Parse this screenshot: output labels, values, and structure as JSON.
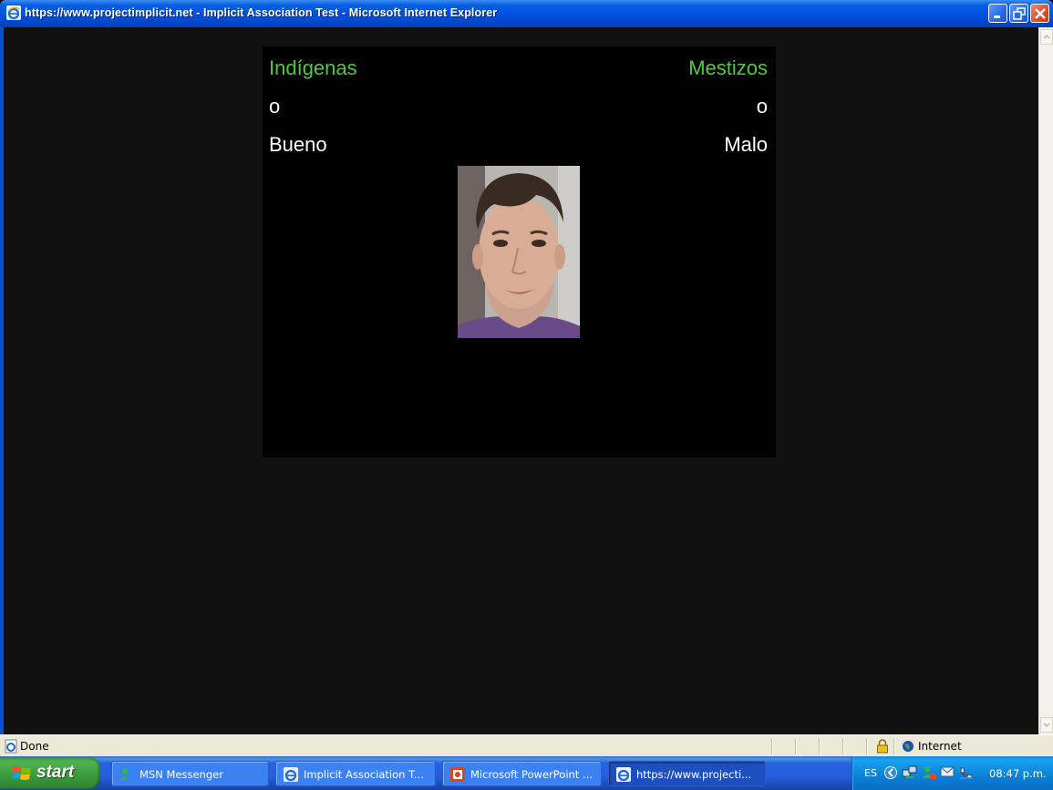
{
  "window": {
    "title": "https://www.projectimplicit.net - Implicit Association Test - Microsoft Internet Explorer"
  },
  "iat": {
    "left_top": "Indígenas",
    "left_or": "o",
    "left_bottom": "Bueno",
    "right_top": "Mestizos",
    "right_or": "o",
    "right_bottom": "Malo",
    "stimulus_icon": "face-photo"
  },
  "statusbar": {
    "status": "Done",
    "zone": "Internet"
  },
  "taskbar": {
    "start_label": "start",
    "tasks": [
      {
        "label": "MSN Messenger"
      },
      {
        "label": "Implicit Association T..."
      },
      {
        "label": "Microsoft PowerPoint ..."
      },
      {
        "label": "https://www.projecti..."
      }
    ],
    "language": "ES",
    "clock": "08:47 p.m."
  },
  "colors": {
    "target_category": "#4ccc3c",
    "attribute_category": "#ffffff",
    "stage_background": "#000000",
    "page_background": "#111111"
  }
}
